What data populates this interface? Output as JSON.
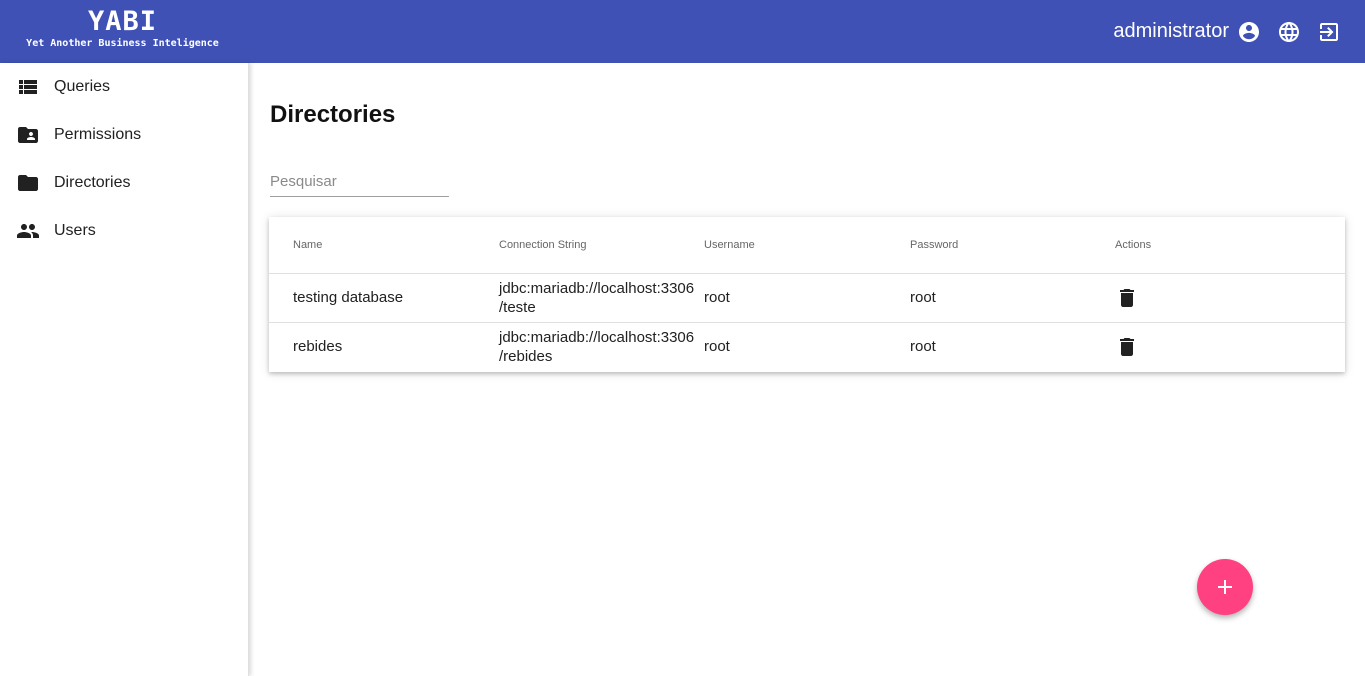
{
  "header": {
    "app_title": "YABI",
    "app_subtitle": "Yet Another Business Inteligence",
    "user_name": "administrator",
    "icons": [
      "account-circle-icon",
      "globe-icon",
      "logout-icon"
    ]
  },
  "sidebar": {
    "items": [
      {
        "label": "Queries",
        "icon": "list-icon"
      },
      {
        "label": "Permissions",
        "icon": "folder-shared-icon"
      },
      {
        "label": "Directories",
        "icon": "folder-icon"
      },
      {
        "label": "Users",
        "icon": "people-icon"
      }
    ]
  },
  "main": {
    "title": "Directories",
    "search": {
      "placeholder": "Pesquisar",
      "value": ""
    },
    "table": {
      "columns": [
        "Name",
        "Connection String",
        "Username",
        "Password",
        "Actions"
      ],
      "rows": [
        {
          "name": "testing database",
          "conn_line1": "jdbc:mariadb://localhost:3306",
          "conn_line2": "/teste",
          "username": "root",
          "password": "root",
          "action_icon": "delete-icon"
        },
        {
          "name": "rebides",
          "conn_line1": "jdbc:mariadb://localhost:3306",
          "conn_line2": "/rebides",
          "username": "root",
          "password": "root",
          "action_icon": "delete-icon"
        }
      ]
    }
  },
  "fab": {
    "icon": "add-icon",
    "color": "#ff4081"
  },
  "colors": {
    "primary": "#3f51b5",
    "accent": "#ff4081"
  }
}
